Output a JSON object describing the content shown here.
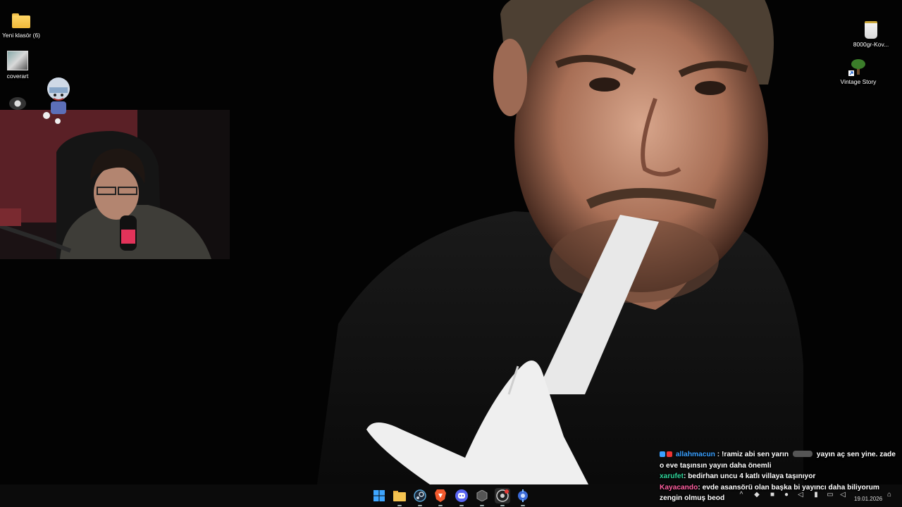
{
  "desktop": {
    "icons": [
      {
        "label": "Yeni klasör (6)",
        "icon": "folder-icon"
      },
      {
        "label": "coverart",
        "icon": "image-icon"
      },
      {
        "label": "",
        "icon": "app-icon"
      },
      {
        "label": "8000gr-Kov...",
        "icon": "bucket-icon"
      },
      {
        "label": "Vintage Story",
        "icon": "tree-shortcut-icon"
      }
    ]
  },
  "chat": {
    "messages": [
      {
        "user": "allahmacun",
        "user_color": "#3aa0ff",
        "text": ": !ramiz abi sen yarın",
        "text2": "yayın aç sen yine. zade o eve taşınsın yayın daha önemli"
      },
      {
        "user": "xarufet",
        "user_color": "#2fd49a",
        "text": ": bedirhan uncu 4 katlı villaya taşınıyor"
      },
      {
        "user": "Kayacando",
        "user_color": "#ff5fa0",
        "text": ": evde asansörü olan başka bi yayıncı daha biliyorum zengin olmuş beod"
      }
    ]
  },
  "taskbar": {
    "apps": [
      {
        "name": "start",
        "icon": "windows-start-icon",
        "color": "#3ea6ff"
      },
      {
        "name": "file-explorer",
        "icon": "folder-icon",
        "color": "#f5c451"
      },
      {
        "name": "steam",
        "icon": "steam-icon",
        "color": "#5aa7d8"
      },
      {
        "name": "brave",
        "icon": "brave-icon",
        "color": "#f25a2e"
      },
      {
        "name": "discord",
        "icon": "discord-icon",
        "color": "#5865f2"
      },
      {
        "name": "obs",
        "icon": "cube-icon",
        "color": "#888888"
      },
      {
        "name": "obs-studio",
        "icon": "obs-icon",
        "color": "#d0d0d0"
      },
      {
        "name": "launcher",
        "icon": "gear-blue-icon",
        "color": "#7ab6ff"
      }
    ],
    "date": "19.01.2026"
  }
}
